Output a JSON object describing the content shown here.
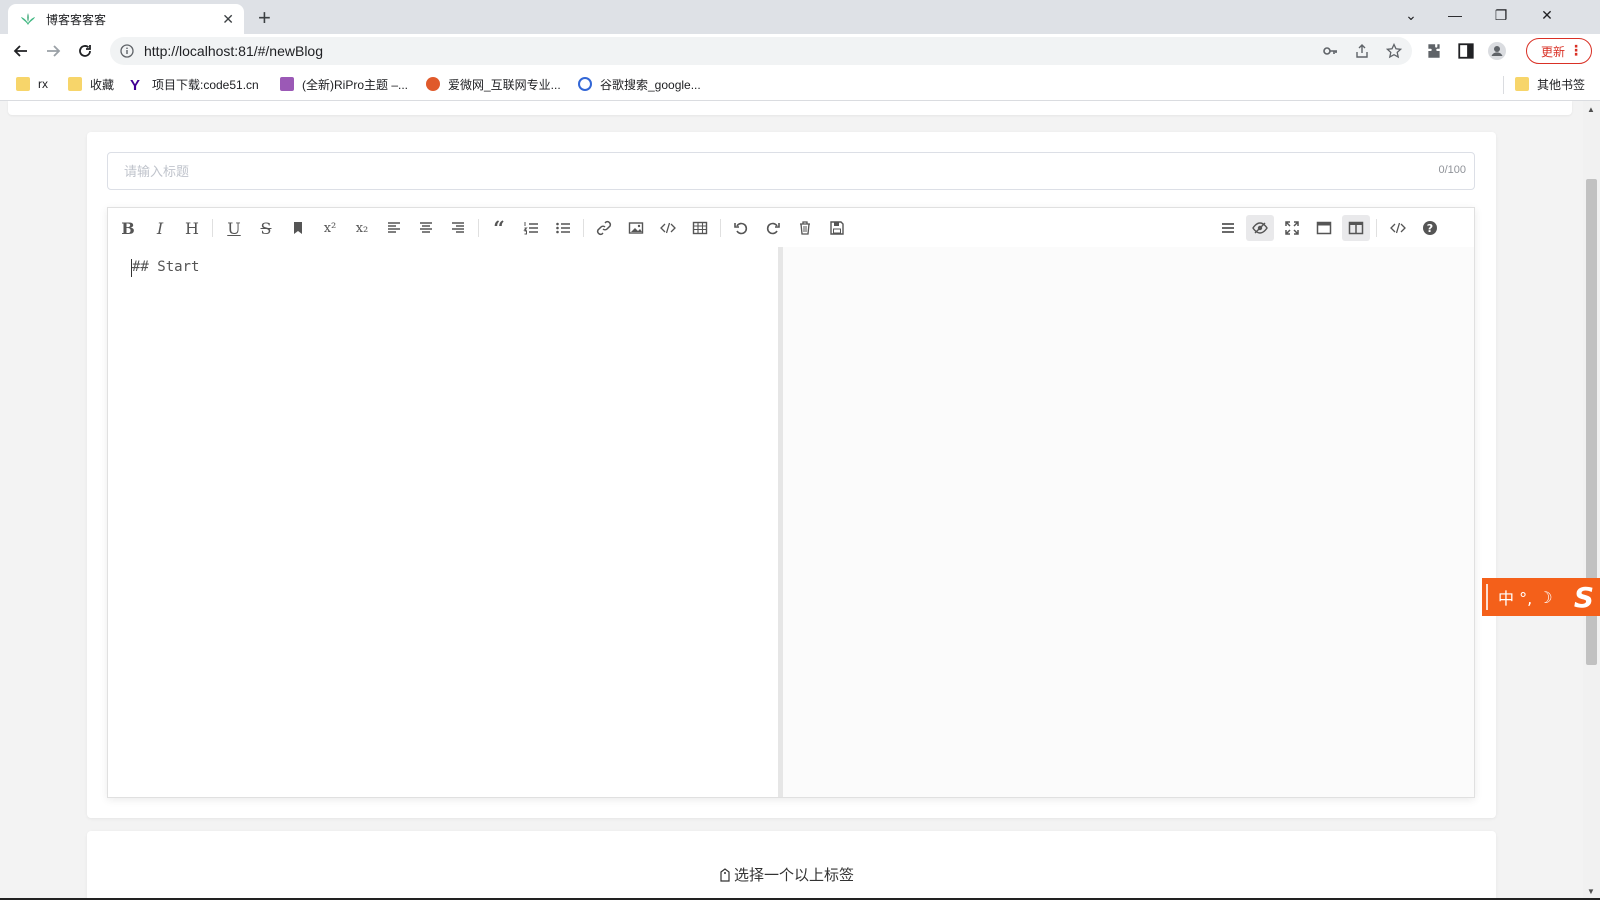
{
  "browser": {
    "tab_title": "博客客客客",
    "url": "http://localhost:81/#/newBlog",
    "update_label": "更新",
    "bookmarks": [
      {
        "label": "rx",
        "icon": "folder-icon"
      },
      {
        "label": "收藏",
        "icon": "folder-icon"
      },
      {
        "label": "项目下载:code51.cn",
        "icon": "yahoo-icon"
      },
      {
        "label": "(全新)RiPro主题 –...",
        "icon": "site-icon"
      },
      {
        "label": "爱微网_互联网专业...",
        "icon": "site-icon"
      },
      {
        "label": "谷歌搜索_google...",
        "icon": "site-icon"
      }
    ],
    "other_bookmarks": "其他书签"
  },
  "editor": {
    "title_placeholder": "请输入标题",
    "title_counter": "0/100",
    "content": "## Start",
    "toolbar_left": [
      "bold",
      "italic",
      "header",
      "underline",
      "strikethrough",
      "mark",
      "superscript",
      "subscript",
      "align-left",
      "align-center",
      "align-right",
      "quote",
      "ordered-list",
      "unordered-list",
      "link",
      "image",
      "code",
      "table",
      "undo",
      "redo",
      "trash",
      "save"
    ],
    "toolbar_right": [
      "navigation",
      "preview",
      "fullscreen",
      "read-mode",
      "subfield",
      "html-code",
      "help"
    ]
  },
  "tags": {
    "label": "选择一个以上标签"
  },
  "ime": {
    "text": "中 °,"
  },
  "colors": {
    "accent_ime": "#f4601a",
    "update_red": "#d93025"
  }
}
